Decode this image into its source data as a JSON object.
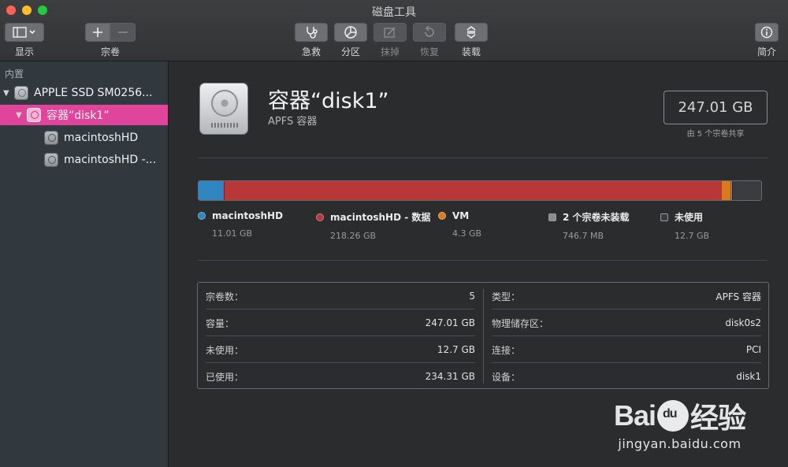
{
  "window": {
    "title": "磁盘工具"
  },
  "toolbar": {
    "view_label": "显示",
    "volume_label": "宗卷",
    "first_aid_label": "急救",
    "partition_label": "分区",
    "erase_label": "抹掉",
    "restore_label": "恢复",
    "mount_label": "装载",
    "info_label": "简介"
  },
  "sidebar": {
    "section": "内置",
    "disk": "APPLE SSD SM0256...",
    "container": "容器“disk1”",
    "volumes": [
      "macintoshHD",
      "macintoshHD -..."
    ]
  },
  "header": {
    "title": "容器“disk1”",
    "subtitle": "APFS 容器",
    "capacity": "247.01 GB",
    "capacity_note": "由 5 个宗卷共享"
  },
  "usage": {
    "total_gb": 247.01,
    "segments": [
      {
        "name": "macintoshHD",
        "size": "11.01 GB",
        "gb": 11.01,
        "color": "#2f86c0",
        "marker": "dot"
      },
      {
        "name": "macintoshHD - 数据",
        "size": "218.26 GB",
        "gb": 218.26,
        "color": "#b8383a",
        "marker": "dot"
      },
      {
        "name": "VM",
        "size": "4.3 GB",
        "gb": 4.3,
        "color": "#d97a1f",
        "marker": "dot"
      },
      {
        "name": "2 个宗卷未装载",
        "size": "746.7 MB",
        "gb": 0.7467,
        "color": "#8d8d8d",
        "marker": "square"
      },
      {
        "name": "未使用",
        "size": "12.7 GB",
        "gb": 12.7,
        "color": "#3b3c3f",
        "marker": "square"
      }
    ]
  },
  "info": {
    "left": [
      {
        "key": "宗卷数：",
        "value": "5"
      },
      {
        "key": "容量：",
        "value": "247.01 GB"
      },
      {
        "key": "未使用：",
        "value": "12.7 GB"
      },
      {
        "key": "已使用：",
        "value": "234.31 GB"
      }
    ],
    "right": [
      {
        "key": "类型：",
        "value": "APFS 容器"
      },
      {
        "key": "物理储存区：",
        "value": "disk0s2"
      },
      {
        "key": "连接：",
        "value": "PCI"
      },
      {
        "key": "设备：",
        "value": "disk1"
      }
    ]
  },
  "watermark": {
    "logo_text": "Bai",
    "logo_suffix": "经验",
    "url": "jingyan.baidu.com"
  }
}
